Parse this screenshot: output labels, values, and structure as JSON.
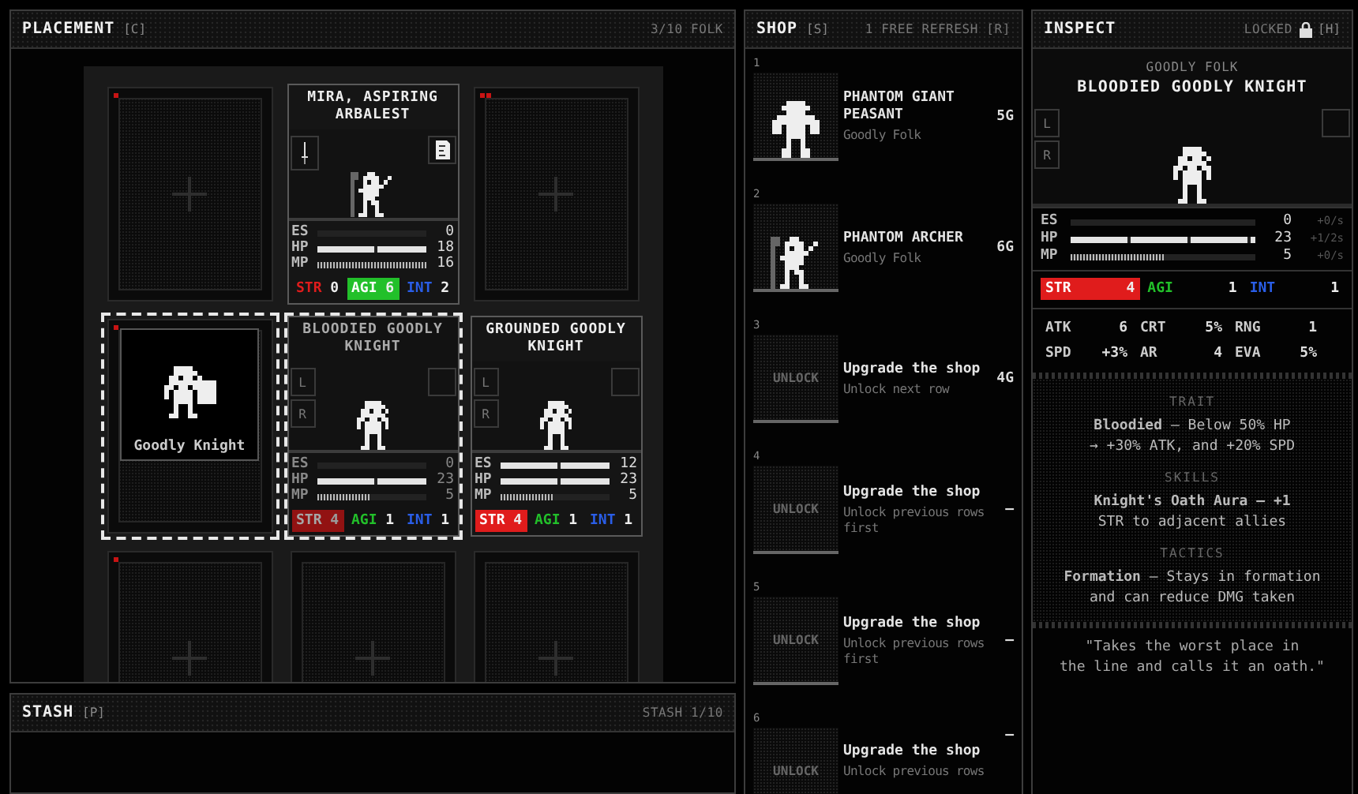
{
  "placement": {
    "title": "PLACEMENT",
    "hotkey": "[C]",
    "count": "3/10 FOLK",
    "slots": [
      {
        "kind": "empty",
        "selected": false,
        "markers": [
          {
            "color": "#c81414"
          }
        ]
      },
      {
        "kind": "unit",
        "selected": false,
        "dimmed": false,
        "name": "MIRA, ASPIRING ARBALEST",
        "left_gear": [
          {
            "kind": "blade"
          }
        ],
        "right_gear": [
          {
            "kind": "scroll"
          }
        ],
        "figure": {
          "kind": "archer"
        },
        "bars": [
          {
            "label": "ES",
            "level": 0,
            "value": "0"
          },
          {
            "label": "HP",
            "level": 1,
            "value": "18"
          },
          {
            "label": "MP",
            "level": 1,
            "value": "16"
          }
        ],
        "stats": [
          {
            "kind": "str",
            "label": "STR",
            "value": "0",
            "highlighted": false
          },
          {
            "kind": "agi",
            "label": "AGI",
            "value": "6",
            "highlighted": true
          },
          {
            "kind": "int",
            "label": "INT",
            "value": "2",
            "highlighted": false
          }
        ]
      },
      {
        "kind": "empty",
        "selected": false,
        "markers": [
          {
            "color": "#c81414"
          },
          {
            "color": "#c81414"
          }
        ]
      },
      {
        "kind": "drag",
        "selected": true,
        "markers": [
          {
            "color": "#c81414"
          }
        ],
        "label": "Goodly Knight",
        "figure": {
          "kind": "guard"
        }
      },
      {
        "kind": "unit",
        "selected": true,
        "dimmed": true,
        "name": "BLOODIED GOODLY KNIGHT",
        "side_labels": [
          "L",
          "R"
        ],
        "right_gear": [
          {
            "kind": "empty"
          }
        ],
        "figure": {
          "kind": "knight"
        },
        "bars": [
          {
            "label": "ES",
            "level": 0,
            "value": "0"
          },
          {
            "label": "HP",
            "level": 1,
            "value": "23"
          },
          {
            "label": "MP",
            "level": 0.5,
            "value": "5"
          }
        ],
        "stats": [
          {
            "kind": "str",
            "label": "STR",
            "value": "4",
            "highlighted": true
          },
          {
            "kind": "agi",
            "label": "AGI",
            "value": "1",
            "highlighted": false
          },
          {
            "kind": "int",
            "label": "INT",
            "value": "1",
            "highlighted": false
          }
        ]
      },
      {
        "kind": "unit",
        "selected": false,
        "dimmed": false,
        "name": "GROUNDED GOODLY KNIGHT",
        "side_labels": [
          "L",
          "R"
        ],
        "right_gear": [
          {
            "kind": "empty"
          }
        ],
        "figure": {
          "kind": "knight"
        },
        "bars": [
          {
            "label": "ES",
            "level": 1,
            "value": "12"
          },
          {
            "label": "HP",
            "level": 1,
            "value": "23"
          },
          {
            "label": "MP",
            "level": 0.5,
            "value": "5"
          }
        ],
        "stats": [
          {
            "kind": "str",
            "label": "STR",
            "value": "4",
            "highlighted": true
          },
          {
            "kind": "agi",
            "label": "AGI",
            "value": "1",
            "highlighted": false
          },
          {
            "kind": "int",
            "label": "INT",
            "value": "1",
            "highlighted": false
          }
        ]
      },
      {
        "kind": "empty",
        "selected": false,
        "markers": [
          {
            "color": "#c81414"
          }
        ]
      },
      {
        "kind": "empty",
        "selected": false
      },
      {
        "kind": "empty",
        "selected": false
      }
    ]
  },
  "stash": {
    "title": "STASH",
    "hotkey": "[P]",
    "count": "STASH 1/10"
  },
  "shop": {
    "title": "SHOP",
    "hotkey": "[S]",
    "info": "1 FREE REFRESH [R]",
    "items": [
      {
        "index": "1",
        "kind": "unit",
        "figure": {
          "kind": "peasant"
        },
        "name": "PHANTOM GIANT PEASANT",
        "subtitle": "Goodly Folk",
        "price": "5G"
      },
      {
        "index": "2",
        "kind": "unit",
        "figure": {
          "kind": "archer"
        },
        "name": "PHANTOM ARCHER",
        "subtitle": "Goodly Folk",
        "price": "6G"
      },
      {
        "index": "3",
        "kind": "locked",
        "label": "UNLOCK",
        "name": "Upgrade the shop",
        "subtitle": "Unlock next row",
        "price": "4G"
      },
      {
        "index": "4",
        "kind": "locked",
        "label": "UNLOCK",
        "name": "Upgrade the shop",
        "subtitle": "Unlock previous rows first",
        "price": "—"
      },
      {
        "index": "5",
        "kind": "locked",
        "label": "UNLOCK",
        "name": "Upgrade the shop",
        "subtitle": "Unlock previous rows first",
        "price": "—"
      },
      {
        "index": "6",
        "kind": "locked",
        "label": "UNLOCK",
        "name": "Upgrade the shop",
        "subtitle": "Unlock previous rows",
        "price": "—"
      }
    ]
  },
  "inspect": {
    "title": "INSPECT",
    "status": "LOCKED",
    "locked": true,
    "hotkey": "[H]",
    "family": "GOODLY FOLK",
    "name": "BLOODIED GOODLY KNIGHT",
    "side_labels": [
      "L",
      "R"
    ],
    "right_gear": [
      {
        "kind": "empty"
      }
    ],
    "figure": {
      "kind": "knight"
    },
    "bars": [
      {
        "label": "ES",
        "level": 0,
        "value": "0",
        "regen": "+0/s"
      },
      {
        "label": "HP",
        "level": 1,
        "value": "23",
        "regen": "+1/2s"
      },
      {
        "label": "MP",
        "level": 0.5,
        "value": "5",
        "regen": "+0/s"
      }
    ],
    "stats": [
      {
        "kind": "str",
        "label": "STR",
        "value": "4",
        "highlighted": true
      },
      {
        "kind": "agi",
        "label": "AGI",
        "value": "1",
        "highlighted": false
      },
      {
        "kind": "int",
        "label": "INT",
        "value": "1",
        "highlighted": false
      }
    ],
    "attributes": [
      {
        "label": "ATK",
        "value": "6"
      },
      {
        "label": "CRT",
        "value": "5%"
      },
      {
        "label": "RNG",
        "value": "1"
      },
      {
        "label": "SPD",
        "value": "+3%"
      },
      {
        "label": "AR",
        "value": "4"
      },
      {
        "label": "EVA",
        "value": "5%"
      }
    ],
    "sections": [
      {
        "heading": "TRAIT",
        "text": "**Bloodied** — Below 50% HP\n→ +30% ATK, and +20% SPD"
      },
      {
        "heading": "SKILLS",
        "text": "**Knight's Oath Aura — +1**\nSTR to adjacent allies"
      },
      {
        "heading": "TACTICS",
        "text": "**Formation** — Stays in formation\nand can reduce DMG taken"
      }
    ],
    "quote": "\"Takes the worst place in\nthe line and calls it an oath.\""
  }
}
